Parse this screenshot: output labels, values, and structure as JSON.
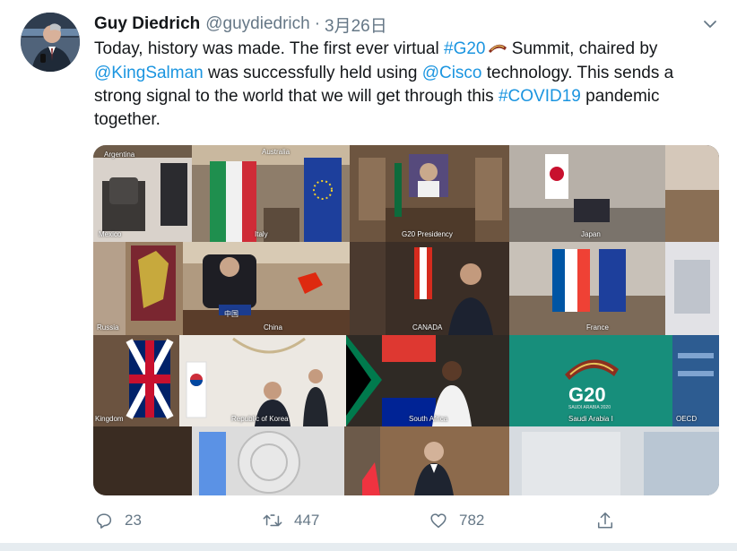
{
  "tweet": {
    "author_name": "Guy Diedrich",
    "handle": "@guydiedrich",
    "separator": "·",
    "date": "3月26日",
    "text": {
      "p1": "Today, history was made. The first ever virtual ",
      "hashtag_g20": "#G20",
      "p2": " Summit, chaired by ",
      "mention_king": "@KingSalman",
      "p3": " was successfully held using ",
      "mention_cisco": "@Cisco",
      "p4": " technology. This sends a strong signal to the world that we will get through this ",
      "hashtag_covid": "#COVID19",
      "p5": " pandemic together."
    },
    "media": {
      "tiles": [
        {
          "label": "Argentina"
        },
        {
          "label": "Mexico"
        },
        {
          "label": "Australia"
        },
        {
          "label": "Italy"
        },
        {
          "label": "G20 Presidency"
        },
        {
          "label": "Japan"
        },
        {
          "label": "Russia"
        },
        {
          "label": "China"
        },
        {
          "label": "中国"
        },
        {
          "label": "CANADA"
        },
        {
          "label": "France"
        },
        {
          "label": "Kingdom"
        },
        {
          "label": "Republic of Korea"
        },
        {
          "label": "South Africa"
        },
        {
          "label": "Saudi Arabia I"
        },
        {
          "label": "OECD"
        }
      ],
      "g20_logo_text": "G20",
      "g20_logo_subtitle": "SAUDI ARABIA 2020"
    },
    "actions": {
      "replies": "23",
      "retweets": "447",
      "likes": "782"
    }
  },
  "icons": {
    "caret": "chevron-down-icon",
    "reply": "reply-icon",
    "retweet": "retweet-icon",
    "like": "heart-icon",
    "share": "share-icon"
  },
  "colors": {
    "link": "#1b95e0",
    "secondary_text": "#657786",
    "primary_text": "#14171a"
  }
}
